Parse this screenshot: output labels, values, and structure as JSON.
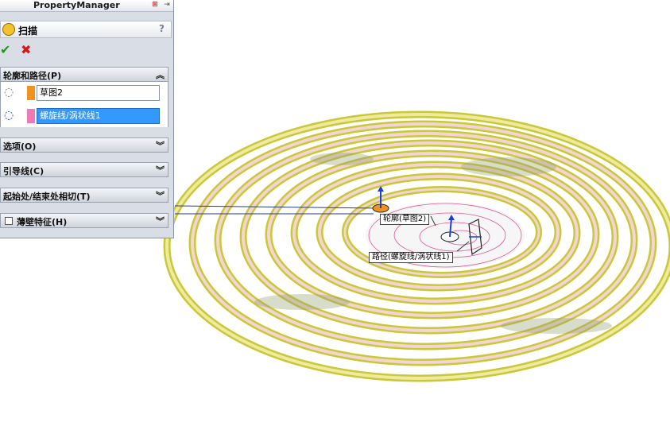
{
  "property_manager": {
    "title": "PropertyManager",
    "feature_title": "扫描",
    "help_label": "?",
    "ok_label": "✔",
    "cancel_label": "✖"
  },
  "groups": [
    {
      "label": "轮廓和路径(P)",
      "state": "expanded"
    },
    {
      "label": "选项(O)",
      "state": "collapsed"
    },
    {
      "label": "引导线(C)",
      "state": "collapsed"
    },
    {
      "label": "起始处/结束处相切(T)",
      "state": "collapsed"
    },
    {
      "label": "薄壁特征(H)",
      "state": "collapsed",
      "checkbox": true
    }
  ],
  "profile_path": {
    "profile_value": "草图2",
    "profile_color": "#f0921e",
    "path_value": "螺旋线/涡状线1",
    "path_color": "#f07ab8"
  },
  "callouts": {
    "profile": "轮廓(草图2)",
    "path": "路径(螺旋线/涡状线1)"
  },
  "colors": {
    "spiral_outer": "#c8c83a",
    "spiral_inner": "#f3c9d2",
    "path_line": "#e2559a",
    "selection": "#3399ff"
  }
}
